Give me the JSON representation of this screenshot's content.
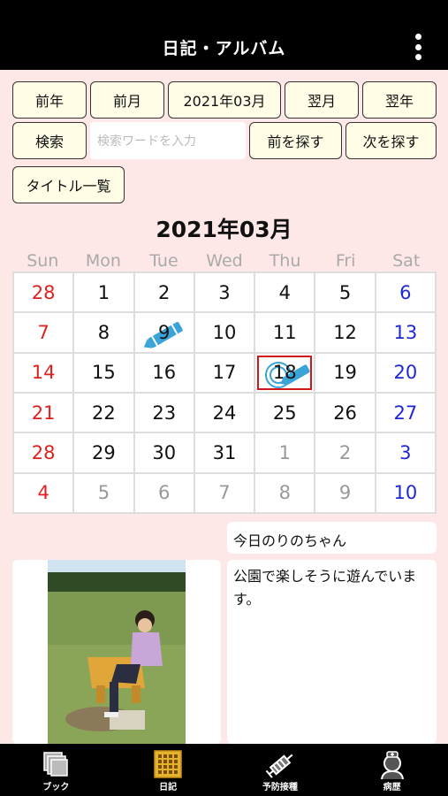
{
  "header": {
    "title": "日記・アルバム",
    "menu_icon": "more-vertical-icon"
  },
  "nav": {
    "prev_year": "前年",
    "prev_month": "前月",
    "current": "2021年03月",
    "next_month": "翌月",
    "next_year": "翌年"
  },
  "search": {
    "button": "検索",
    "placeholder": "検索ワードを入力",
    "find_prev": "前を探す",
    "find_next": "次を探す"
  },
  "title_list": "タイトル一覧",
  "calendar": {
    "month_title": "2021年03月",
    "weekdays": [
      "Sun",
      "Mon",
      "Tue",
      "Wed",
      "Thu",
      "Fri",
      "Sat"
    ],
    "days": [
      "28",
      "1",
      "2",
      "3",
      "4",
      "5",
      "6",
      "7",
      "8",
      "9",
      "10",
      "11",
      "12",
      "13",
      "14",
      "15",
      "16",
      "17",
      "18",
      "19",
      "20",
      "21",
      "22",
      "23",
      "24",
      "25",
      "26",
      "27",
      "28",
      "29",
      "30",
      "31",
      "1",
      "2",
      "3",
      "4",
      "5",
      "6",
      "7",
      "8",
      "9",
      "10"
    ],
    "today_index": 18,
    "diary_marks": [
      9,
      18
    ],
    "colors": {
      "sunday": "#e0201e",
      "saturday": "#1d27d6",
      "other": "#999999",
      "mark": "#3aa3d8",
      "today_border": "#d01818"
    }
  },
  "entry": {
    "title": "今日のりのちゃん",
    "body": "公園で楽しそうに遊んでいます。"
  },
  "tabs": [
    {
      "label": "ブック",
      "icon": "book-stack-icon"
    },
    {
      "label": "日記",
      "icon": "calendar-grid-icon",
      "active": true
    },
    {
      "label": "予防接種",
      "icon": "syringe-icon"
    },
    {
      "label": "病歴",
      "icon": "doctor-icon"
    }
  ]
}
